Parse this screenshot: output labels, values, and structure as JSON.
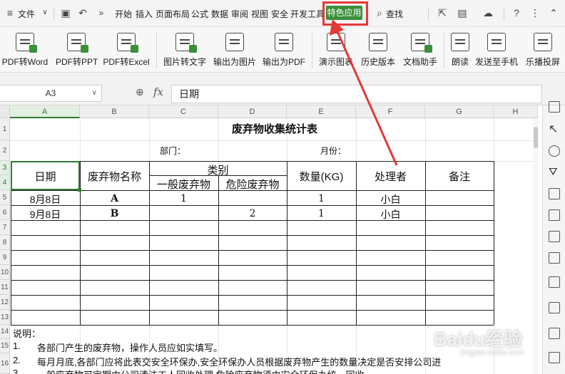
{
  "menu": {
    "file": "文件",
    "tabs": [
      "开始",
      "插入",
      "页面布局",
      "公式",
      "数据",
      "审阅",
      "视图",
      "安全",
      "开发工具"
    ],
    "special_tab": "特色应用",
    "search": "查找"
  },
  "ribbon": {
    "buttons": [
      "PDF转Word",
      "PDF转PPT",
      "PDF转Excel",
      "图片转文字",
      "输出为图片",
      "输出为PDF",
      "演示图表",
      "历史版本",
      "文档助手",
      "朗读",
      "发送至手机",
      "乐播投屏"
    ]
  },
  "formula_bar": {
    "name_box": "A3",
    "fx": "fx",
    "value": "日期"
  },
  "sheet": {
    "columns": [
      "A",
      "B",
      "C",
      "D",
      "E",
      "F",
      "G",
      "H"
    ],
    "rows": [
      "1",
      "2",
      "3",
      "4",
      "5",
      "6",
      "7",
      "8",
      "9",
      "10",
      "11",
      "12",
      "13",
      "14",
      "15",
      "16"
    ],
    "title": "废弃物收集统计表",
    "dept_label": "部门：",
    "month_label": "月份：",
    "headers": {
      "date": "日期",
      "waste_name": "废弃物名称",
      "category": "类别",
      "general": "一般废弃物",
      "hazardous": "危险废弃物",
      "quantity": "数量(KG)",
      "handler": "处理者",
      "remark": "备注"
    },
    "records": [
      {
        "date": "8月8日",
        "name": "A",
        "general": "1",
        "hazardous": "",
        "qty": "1",
        "handler": "小白"
      },
      {
        "date": "9月8日",
        "name": "B",
        "general": "",
        "hazardous": "2",
        "qty": "1",
        "handler": "小白"
      }
    ],
    "notes_title": "说明：",
    "notes": [
      {
        "num": "1.",
        "text": "各部门产生的废弃物，操作人员应如实填写。"
      },
      {
        "num": "2.",
        "text": "每月月底,各部门应将此表交安全环保办,安全环保办人员根据废弃物产生的数量决定是否安排公司进"
      },
      {
        "num": "3.",
        "text": "一般废弃物可定期由公司清洁工人回收处理,危险废弃物须由安全环保办统一回收"
      }
    ]
  },
  "watermark": "Baidu经验",
  "watermark_sub": "jingyan.baidu.com",
  "colors": {
    "accent_green": "#3b8f3b",
    "highlight_red": "#e53935"
  }
}
